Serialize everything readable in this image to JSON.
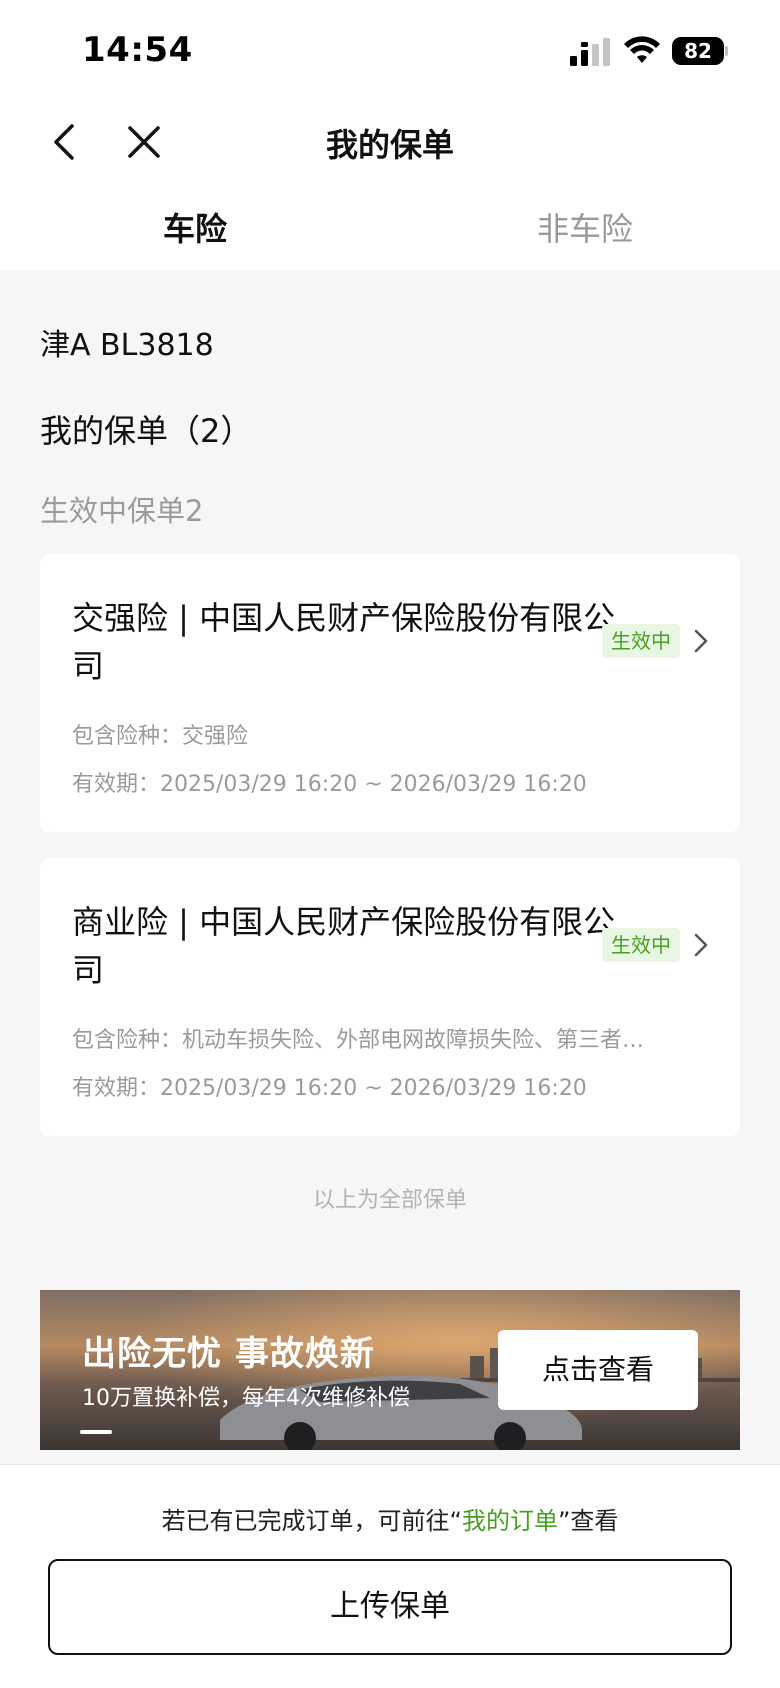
{
  "status_bar": {
    "time": "14:54",
    "battery": "82"
  },
  "nav": {
    "title": "我的保单"
  },
  "tabs": [
    {
      "label": "车险",
      "active": true
    },
    {
      "label": "非车险",
      "active": false
    }
  ],
  "plate_number": "津A BL3818",
  "my_policies_label": "我的保单（2）",
  "active_section_label": "生效中保单2",
  "policies": [
    {
      "title": "交强险 | 中国人民财产保险股份有限公司",
      "status": "生效中",
      "coverage": "包含险种：交强险",
      "validity": "有效期：2025/03/29 16:20 ~ 2026/03/29 16:20"
    },
    {
      "title": "商业险 | 中国人民财产保险股份有限公司",
      "status": "生效中",
      "coverage": "包含险种：机动车损失险、外部电网故障损失险、第三者…",
      "validity": "有效期：2025/03/29 16:20 ~ 2026/03/29 16:20"
    }
  ],
  "end_note": "以上为全部保单",
  "banner": {
    "title": "出险无忧 事故焕新",
    "subtitle": "10万置换补偿，每年4次维修补偿",
    "button": "点击查看"
  },
  "bottom": {
    "tip_prefix": "若已有已完成订单，可前往“",
    "tip_link": "我的订单",
    "tip_suffix": "”查看",
    "upload_button": "上传保单"
  },
  "colors": {
    "accent_green": "#47a020",
    "badge_bg": "#eaf6e4",
    "page_bg": "#f6f6f6"
  },
  "icons": [
    "cellular-signal-icon",
    "wifi-icon",
    "battery-icon",
    "back-arrow-icon",
    "close-icon",
    "chevron-right-icon"
  ]
}
